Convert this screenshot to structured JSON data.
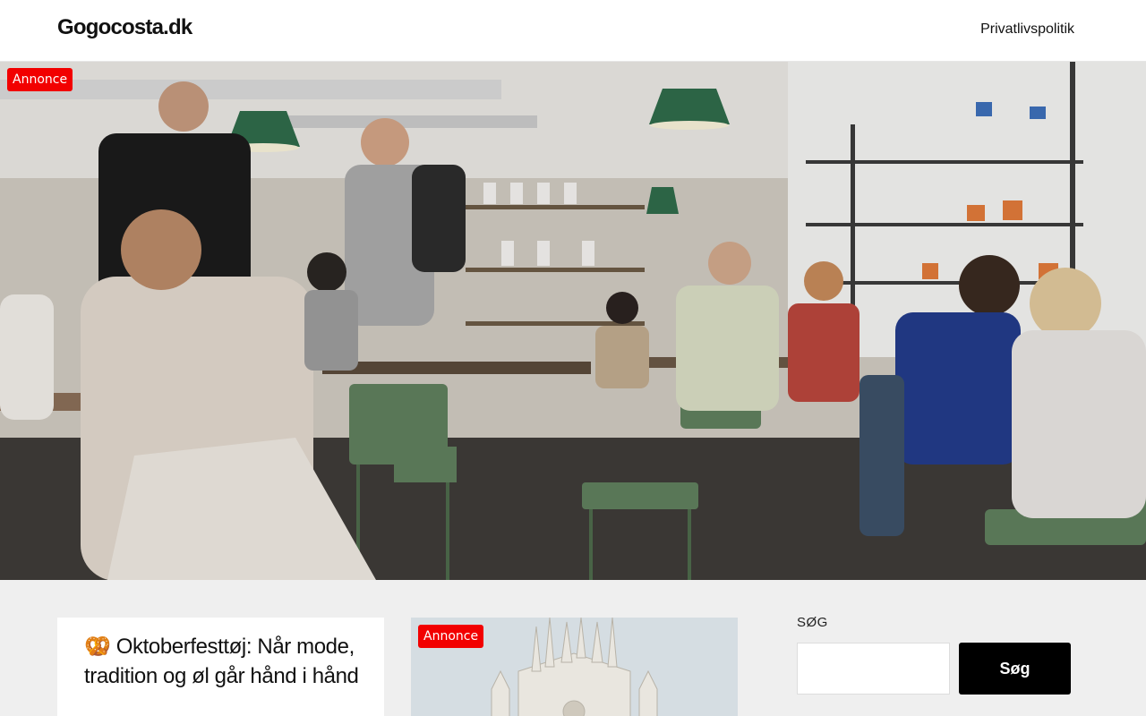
{
  "header": {
    "site_title": "Gogocosta.dk",
    "nav": [
      {
        "label": "Privatlivspolitik"
      }
    ]
  },
  "hero": {
    "badge": "Annonce",
    "image": "cafe-interior-photo"
  },
  "posts": [
    {
      "title": "🥨 Oktoberfesttøj: Når mode, tradition og øl går hånd i hånd"
    },
    {
      "badge": "Annonce",
      "image": "cathedral-photo"
    }
  ],
  "sidebar": {
    "search_label": "SØG",
    "search_value": "",
    "search_button": "Søg"
  }
}
